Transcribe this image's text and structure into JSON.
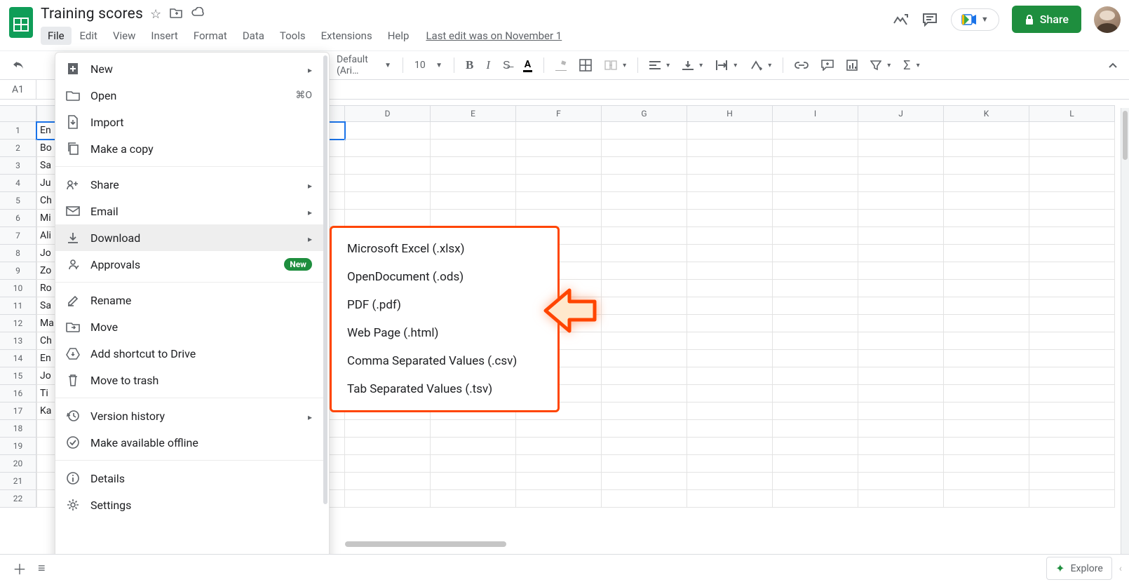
{
  "doc": {
    "title": "Training scores"
  },
  "menus": {
    "file": "File",
    "edit": "Edit",
    "view": "View",
    "insert": "Insert",
    "format": "Format",
    "data": "Data",
    "tools": "Tools",
    "extensions": "Extensions",
    "help": "Help",
    "last_edit": "Last edit was on November 1"
  },
  "share_button": "Share",
  "toolbar": {
    "font": "Default (Ari…",
    "font_size": "10"
  },
  "namebox": "A1",
  "columns": [
    "D",
    "E",
    "F",
    "G",
    "H",
    "I",
    "J",
    "K",
    "L"
  ],
  "rows": {
    "count": 22,
    "colA": [
      "En",
      "Bo",
      "Sa",
      "Ju",
      "Ch",
      "Mi",
      "Ali",
      "Jo",
      "Zo",
      "Ro",
      "Sa",
      "Ma",
      "Ch",
      "En",
      "Jo",
      "Ti",
      "Ka",
      "",
      "",
      "",
      "",
      ""
    ]
  },
  "file_menu": {
    "new": "New",
    "open": "Open",
    "open_shortcut": "⌘O",
    "import": "Import",
    "make_copy": "Make a copy",
    "share": "Share",
    "email": "Email",
    "download": "Download",
    "approvals": "Approvals",
    "approvals_badge": "New",
    "rename": "Rename",
    "move": "Move",
    "add_shortcut": "Add shortcut to Drive",
    "move_to_trash": "Move to trash",
    "version_history": "Version history",
    "offline": "Make available offline",
    "details": "Details",
    "settings": "Settings"
  },
  "download_submenu": {
    "xlsx": "Microsoft Excel (.xlsx)",
    "ods": "OpenDocument (.ods)",
    "pdf": "PDF (.pdf)",
    "html": "Web Page (.html)",
    "csv": "Comma Separated Values (.csv)",
    "tsv": "Tab Separated Values (.tsv)"
  },
  "bottom": {
    "explore": "Explore"
  }
}
